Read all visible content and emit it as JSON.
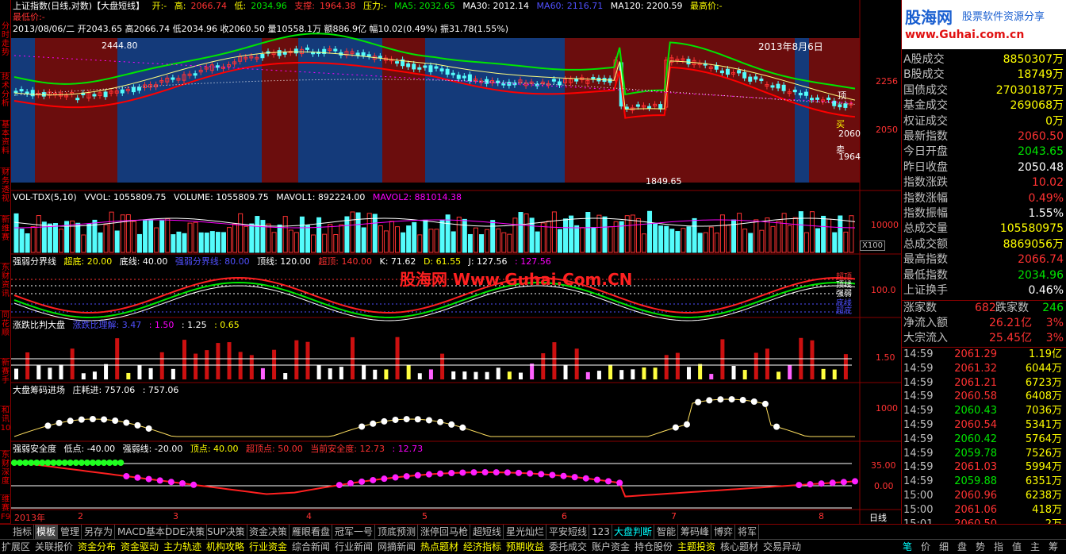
{
  "header": {
    "title": "上证指数(日线,对数)【大盘短线】",
    "open_label": "开:-",
    "high_label": "高:",
    "high_value": "2066.74",
    "low_label": "低:",
    "low_value": "2034.96",
    "support_label": "支撑:",
    "support_value": "1964.38",
    "pressure_label": "压力:-",
    "ma5": "MA5: 2032.65",
    "ma30": "MA30: 2012.14",
    "ma60": "MA60: 2116.71",
    "ma120": "MA120: 2200.59",
    "best_buy": "最高价:-",
    "best_sell": "最低价:-",
    "info_line": "2013/08/06/二 开2043.65 高2066.74 低2034.96 收2060.50 量10558.1万 额886.9亿 幅10.02(0.49%) 振31.78(1.55%)",
    "date_box": "2013年8月6日",
    "price_high_mark": "2444.80",
    "price_low_mark": "1849.65"
  },
  "logo": {
    "line1": "股海网",
    "line2": "股票软件资源分享",
    "url_text": "www.Guhai.com.cn"
  },
  "watermark": "股海网 Www.Guhai.Com.CN",
  "left_tabs": [
    "分时走势",
    "技术分析",
    "基本资料",
    "财务透视",
    "新维赛",
    "东财资讯",
    "同花顺",
    "新赛手",
    "和讯10",
    "东财深度",
    "维赛F9"
  ],
  "panels": {
    "price": {
      "axis": [
        "2256",
        "2050"
      ],
      "labels": [
        "2060",
        "顶",
        "买",
        "1964",
        "卖"
      ]
    },
    "vol": {
      "title": "VOL-TDX(5,10)",
      "vvol": "VVOL: 1055809.75",
      "volume": "VOLUME: 1055809.75",
      "mavol1": "MAVOL1: 892224.00",
      "mavol2": "MAVOL2: 881014.38",
      "axis": "10000",
      "unit": "X100"
    },
    "qr": {
      "title": "强弱分界线",
      "cd": "超底: 20.00",
      "dx": "底线: 40.00",
      "fj": "强弱分界线: 80.00",
      "top": "顶线: 120.00",
      "ct": "超顶: 140.00",
      "k": "K: 71.62",
      "d": "D: 61.55",
      "j": "J: 127.56",
      "j2": ": 127.56",
      "axis": "100.0",
      "rlabels": [
        "超顶",
        "顶线",
        "强弱",
        "底线",
        "超底"
      ]
    },
    "zd": {
      "title": "涨跌比判大盘",
      "v1": "涨跌比理解: 3.47",
      "v2": ": 1.50",
      "v3": ": 1.25",
      "v4": ": 0.65",
      "axis": "1.50"
    },
    "cm": {
      "title": "大盘筹码进场",
      "v1": "庄耗进: 757.06",
      "v2": ": 757.06",
      "axis": "1000"
    },
    "aq": {
      "title": "强弱安全度",
      "low": "低点: -40.00",
      "qr": "强弱线: -20.00",
      "top": "顶点: 40.00",
      "ctop": "超顶点: 50.00",
      "cur": "当前安全度: 12.73",
      "v2": ": 12.73",
      "axis": [
        "35.00",
        "0.00"
      ]
    }
  },
  "time_axis": [
    "2013年",
    "2",
    "3",
    "4",
    "5",
    "6",
    "7",
    "8"
  ],
  "time_mode": "日线",
  "right_panel": {
    "rows": [
      {
        "k": "A股成交",
        "v": "8850307万",
        "c": "#ffff00"
      },
      {
        "k": "B股成交",
        "v": "18749万",
        "c": "#ffff00"
      },
      {
        "k": "国债成交",
        "v": "27030187万",
        "c": "#ffff00"
      },
      {
        "k": "基金成交",
        "v": "269068万",
        "c": "#ffff00"
      },
      {
        "k": "权证成交",
        "v": "0万",
        "c": "#ffff00"
      },
      {
        "k": "最新指数",
        "v": "2060.50",
        "c": "#ff3232"
      },
      {
        "k": "今日开盘",
        "v": "2043.65",
        "c": "#00e600"
      },
      {
        "k": "昨日收盘",
        "v": "2050.48",
        "c": "#ffffff"
      },
      {
        "k": "指数涨跌",
        "v": "10.02",
        "c": "#ff3232"
      },
      {
        "k": "指数涨幅",
        "v": "0.49%",
        "c": "#ff3232"
      },
      {
        "k": "指数振幅",
        "v": "1.55%",
        "c": "#ffffff"
      },
      {
        "k": "总成交量",
        "v": "105580975",
        "c": "#ffff00"
      },
      {
        "k": "总成交额",
        "v": "8869056万",
        "c": "#ffff00"
      },
      {
        "k": "最高指数",
        "v": "2066.74",
        "c": "#ff3232"
      },
      {
        "k": "最低指数",
        "v": "2034.96",
        "c": "#00e600"
      },
      {
        "k": "上证换手",
        "v": "0.46%",
        "c": "#ffffff"
      }
    ],
    "up_label": "涨家数",
    "up_value": "682",
    "down_label": "跌家数",
    "down_value": "246",
    "net_label": "净流入额",
    "net_value": "26.21亿",
    "net_pct": "3%",
    "block_label": "大宗流入",
    "block_value": "25.45亿",
    "block_pct": "3%",
    "ticks": [
      {
        "t": "14:59",
        "p": "2061.29",
        "v": "1.19亿"
      },
      {
        "t": "14:59",
        "p": "2061.32",
        "v": "6044万"
      },
      {
        "t": "14:59",
        "p": "2061.21",
        "v": "6723万"
      },
      {
        "t": "14:59",
        "p": "2060.58",
        "v": "6408万"
      },
      {
        "t": "14:59",
        "p": "2060.43",
        "v": "7036万"
      },
      {
        "t": "14:59",
        "p": "2060.54",
        "v": "5341万"
      },
      {
        "t": "14:59",
        "p": "2060.42",
        "v": "5764万"
      },
      {
        "t": "14:59",
        "p": "2059.78",
        "v": "7526万"
      },
      {
        "t": "14:59",
        "p": "2061.03",
        "v": "5994万"
      },
      {
        "t": "14:59",
        "p": "2059.88",
        "v": "6351万"
      },
      {
        "t": "15:00",
        "p": "2060.96",
        "v": "6238万"
      },
      {
        "t": "15:00",
        "p": "2061.06",
        "v": "418万"
      },
      {
        "t": "15:01",
        "p": "2060.50",
        "v": "2万"
      }
    ]
  },
  "tabbar": [
    "指标",
    "模板",
    "管理",
    "另存为",
    "MACD基本",
    "DDE决策",
    "SUP决策",
    "资金决策",
    "雁眼看盘",
    "冠军一号",
    "顶底预测",
    "涨停回马枪",
    "超短线",
    "星光灿烂",
    "平安短线",
    "123",
    "大盘判断",
    "智能",
    "筹码峰",
    "博弈",
    "将军"
  ],
  "statusbar": [
    "扩展区",
    "关联报价",
    "资金分布",
    "资金驱动",
    "主力轨迹",
    "机构攻略",
    "行业资金",
    "综合新闻",
    "行业新闻",
    "网摘新闻",
    "热点题材",
    "经济指标",
    "预期收益",
    "委托成交",
    "账户资金",
    "持仓股份",
    "主题投资",
    "核心题材",
    "交易异动"
  ],
  "right_tabs": [
    "笔",
    "价",
    "细",
    "盘",
    "势",
    "指",
    "值",
    "主",
    "筹"
  ],
  "colors": {
    "up": "#ff3232",
    "down": "#54fcfc",
    "bg_red": "#6b0d0d",
    "bg_blue": "#143a7a",
    "ma_green": "#00e600",
    "ma_yellow": "#ffff80",
    "magenta": "#ff00ff"
  }
}
